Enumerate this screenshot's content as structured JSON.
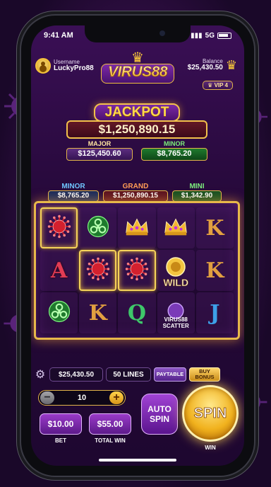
{
  "status": {
    "time": "9:41 AM",
    "network": "5G"
  },
  "header": {
    "user_label": "Username",
    "user_name": "LuckyPro88",
    "logo_text": "VIRUS88",
    "balance_label": "Balance",
    "balance_value": "$25,430.50",
    "vip_label": "VIP 4"
  },
  "jackpot": {
    "title": "JACKPOT",
    "amount": "$1,250,890.15",
    "major_label": "MAJOR",
    "major_value": "$125,450.60",
    "minor_label": "MINOR",
    "minor_value": "$8,765.20"
  },
  "progressives": {
    "minor_label": "MINOR",
    "minor_value": "$8,765.20",
    "grand_label": "GRAND",
    "grand_value": "$1,250,890.15",
    "mini_label": "MINI",
    "mini_value": "$1,342.90"
  },
  "reels": [
    [
      {
        "symbol": "virus-red",
        "highlight": true
      },
      {
        "symbol": "biohazard-green"
      },
      {
        "symbol": "crown"
      },
      {
        "symbol": "crown"
      },
      {
        "symbol": "K"
      }
    ],
    [
      {
        "symbol": "A"
      },
      {
        "symbol": "virus-red",
        "highlight": true
      },
      {
        "symbol": "virus-red",
        "highlight": true
      },
      {
        "symbol": "wild",
        "text": "WILD"
      },
      {
        "symbol": "K"
      }
    ],
    [
      {
        "symbol": "biohazard-green"
      },
      {
        "symbol": "K"
      },
      {
        "symbol": "Q"
      },
      {
        "symbol": "scatter",
        "text": "VIRUS88 SCATTER"
      },
      {
        "symbol": "J"
      }
    ]
  ],
  "controls": {
    "balance": "$25,430.50",
    "lines": "50 LINES",
    "paytable": "PAYTABLE",
    "buy_bonus": "BUY BONUS",
    "stepper_value": "10",
    "bet_value": "$10.00",
    "bet_label": "BET",
    "total_win_value": "$55.00",
    "total_win_label": "TOTAL WIN",
    "auto_spin": "AUTO SPIN",
    "spin": "SPIN",
    "spin_label": "WIN"
  },
  "colors": {
    "gold": "#f2c14b",
    "purple": "#3a0f55",
    "red": "#e23c54"
  }
}
